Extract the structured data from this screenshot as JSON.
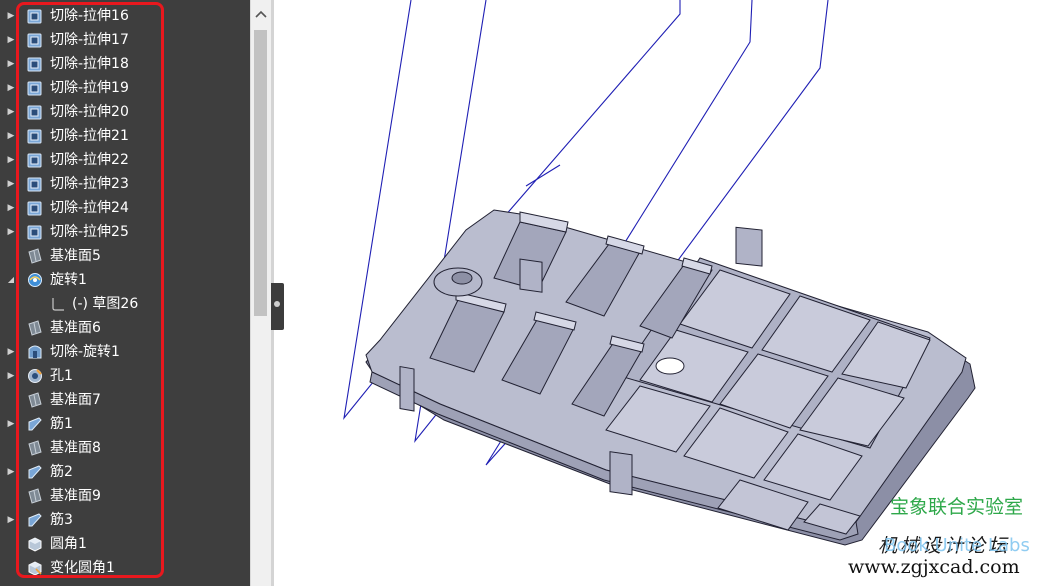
{
  "tree": {
    "items": [
      {
        "label": "切除-拉伸16",
        "icon": "cut-extrude-icon",
        "expandable": true
      },
      {
        "label": "切除-拉伸17",
        "icon": "cut-extrude-icon",
        "expandable": true
      },
      {
        "label": "切除-拉伸18",
        "icon": "cut-extrude-icon",
        "expandable": true
      },
      {
        "label": "切除-拉伸19",
        "icon": "cut-extrude-icon",
        "expandable": true
      },
      {
        "label": "切除-拉伸20",
        "icon": "cut-extrude-icon",
        "expandable": true
      },
      {
        "label": "切除-拉伸21",
        "icon": "cut-extrude-icon",
        "expandable": true
      },
      {
        "label": "切除-拉伸22",
        "icon": "cut-extrude-icon",
        "expandable": true
      },
      {
        "label": "切除-拉伸23",
        "icon": "cut-extrude-icon",
        "expandable": true
      },
      {
        "label": "切除-拉伸24",
        "icon": "cut-extrude-icon",
        "expandable": true
      },
      {
        "label": "切除-拉伸25",
        "icon": "cut-extrude-icon",
        "expandable": true
      },
      {
        "label": "基准面5",
        "icon": "plane-icon",
        "expandable": false
      },
      {
        "label": "旋转1",
        "icon": "revolve-icon",
        "expandable": true,
        "expanded": true
      },
      {
        "label": "(-) 草图26",
        "icon": "sketch-icon",
        "expandable": false,
        "child": true
      },
      {
        "label": "基准面6",
        "icon": "plane-icon",
        "expandable": false
      },
      {
        "label": "切除-旋转1",
        "icon": "cut-revolve-icon",
        "expandable": true
      },
      {
        "label": "孔1",
        "icon": "hole-icon",
        "expandable": true
      },
      {
        "label": "基准面7",
        "icon": "plane-icon",
        "expandable": false
      },
      {
        "label": "筋1",
        "icon": "rib-icon",
        "expandable": true
      },
      {
        "label": "基准面8",
        "icon": "plane-icon",
        "expandable": false
      },
      {
        "label": "筋2",
        "icon": "rib-icon",
        "expandable": true
      },
      {
        "label": "基准面9",
        "icon": "plane-icon",
        "expandable": false
      },
      {
        "label": "筋3",
        "icon": "rib-icon",
        "expandable": true
      },
      {
        "label": "圆角1",
        "icon": "fillet-icon",
        "expandable": false
      },
      {
        "label": "变化圆角1",
        "icon": "variable-fillet-icon",
        "expandable": false
      }
    ]
  },
  "watermark": {
    "brand": "宝象联合实验室",
    "site_cn": "机械设计论坛",
    "overlay": "Book Unite Labs",
    "url": "www.zgjxcad.com"
  },
  "colors": {
    "panel_bg": "#3e3e3e",
    "highlight": "#e8181e",
    "sketch_line": "#1f1fb4",
    "part_face": "#b9bccf",
    "part_edge": "#222233",
    "watermark_green": "#2ea84a"
  }
}
